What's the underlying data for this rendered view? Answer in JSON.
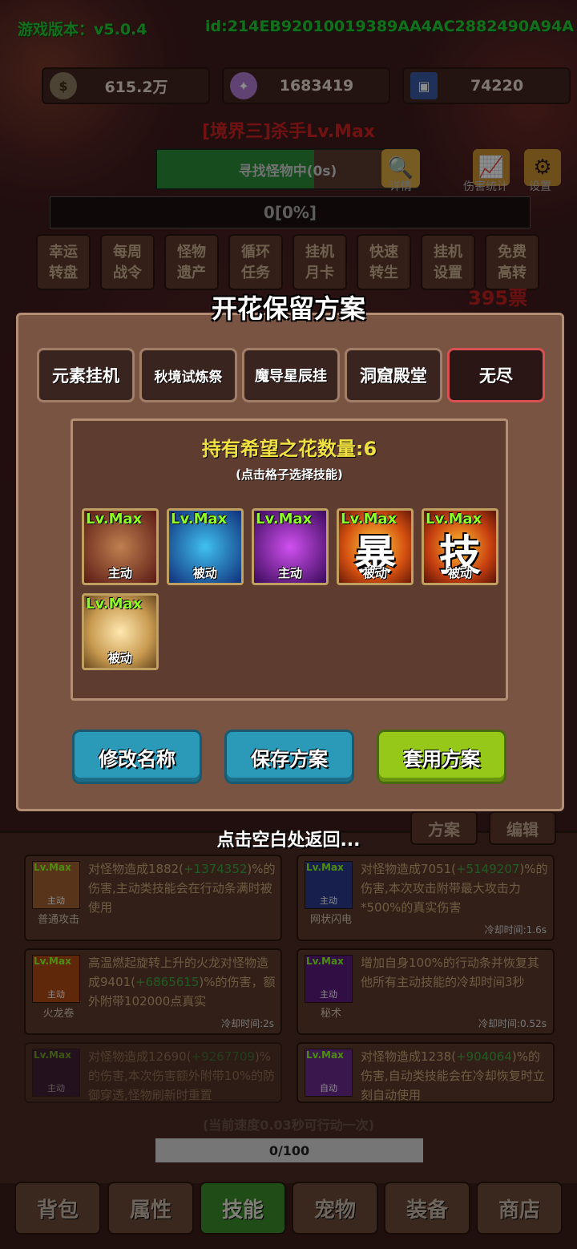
{
  "header": {
    "version_label": "游戏版本：",
    "version": "v5.0.4",
    "player_id": "id:214EB92010019389AA4AC2882490A94A"
  },
  "resources": [
    {
      "icon": "coin-icon",
      "value": "615.2万"
    },
    {
      "icon": "crystal-icon",
      "value": "1683419"
    },
    {
      "icon": "card-icon",
      "value": "74220"
    }
  ],
  "stage_title": "[境界三]杀手Lv.Max",
  "search": {
    "text": "寻找怪物中(0s)",
    "detail_label": "详情",
    "progress": 0.6
  },
  "tools": {
    "damage_stats": "伤害统计",
    "settings": "设置"
  },
  "exp_bar": {
    "text": "0[0%]"
  },
  "quick_menu": [
    {
      "l1": "幸运",
      "l2": "转盘"
    },
    {
      "l1": "每周",
      "l2": "战令"
    },
    {
      "l1": "怪物",
      "l2": "遗产"
    },
    {
      "l1": "循环",
      "l2": "任务"
    },
    {
      "l1": "挂机",
      "l2": "月卡"
    },
    {
      "l1": "快速",
      "l2": "转生"
    },
    {
      "l1": "挂机",
      "l2": "设置"
    },
    {
      "l1": "免费",
      "l2": "高转"
    }
  ],
  "background_counter": "395票",
  "modal": {
    "title": "开花保留方案",
    "tabs": [
      "元素挂机",
      "秋境试炼祭",
      "魔导星辰挂",
      "洞窟殿堂",
      "无尽"
    ],
    "active_tab": 4,
    "hope_count": "持有希望之花数量:6",
    "hint": "(点击格子选择技能)",
    "skills": [
      {
        "level": "Lv.Max",
        "tag": "主动",
        "glyph": "",
        "icon": "drill-icon",
        "color": "#5a1a14"
      },
      {
        "level": "Lv.Max",
        "tag": "被动",
        "glyph": "",
        "icon": "human-aura-icon",
        "color": "#10307a"
      },
      {
        "level": "Lv.Max",
        "tag": "主动",
        "glyph": "",
        "icon": "dark-demon-icon",
        "color": "#6a1a8a"
      },
      {
        "level": "Lv.Max",
        "tag": "被动",
        "glyph": "暴",
        "icon": "crit-fire-icon",
        "color": "#d45010"
      },
      {
        "level": "Lv.Max",
        "tag": "被动",
        "glyph": "技",
        "icon": "skill-fire-icon",
        "color": "#c84010"
      },
      {
        "level": "Lv.Max",
        "tag": "被动",
        "glyph": "",
        "icon": "golden-warrior-icon",
        "color": "#c89a50"
      }
    ],
    "buttons": {
      "rename": "修改名称",
      "save": "保存方案",
      "apply": "套用方案"
    }
  },
  "side_buttons": {
    "plan": "方案",
    "edit": "编辑"
  },
  "back_hint": "点击空白处返回...",
  "skill_cards": [
    {
      "name": "普通攻击",
      "level": "Lv.Max",
      "tag": "主动",
      "color": "#a06030",
      "desc_parts": [
        "对怪物造成1882(",
        "+1374352",
        ")%的伤害,主动类技能会在行动条满时被使用"
      ],
      "cooldown": ""
    },
    {
      "name": "网状闪电",
      "level": "Lv.Max",
      "tag": "主动",
      "color": "#2a3a8a",
      "desc_parts": [
        "对怪物造成7051(",
        "+5149207",
        ")%的伤害,本次攻击附带最大攻击力*500%的真实伤害"
      ],
      "cooldown": "冷却时间:1.6s"
    },
    {
      "name": "火龙卷",
      "level": "Lv.Max",
      "tag": "主动",
      "color": "#b04a14",
      "desc_parts": [
        "高温燃起旋转上升的火龙对怪物造成9401(",
        "+6865615",
        ")%的伤害，额外附带102000点真实"
      ],
      "cooldown": "冷却时间:2s"
    },
    {
      "name": "秘术",
      "level": "Lv.Max",
      "tag": "主动",
      "color": "#5a1a7a",
      "desc_parts": [
        "增加自身100%的行动条并恢复其他所有主动技能的冷却时间3秒",
        "",
        ""
      ],
      "cooldown": "冷却时间:0.52s"
    },
    {
      "name": "",
      "level": "Lv.Max",
      "tag": "主动",
      "color": "#3a1a4a",
      "desc_parts": [
        "对怪物造成12690(",
        "+9267709",
        ")%的伤害,本次伤害额外附带10%的防御穿透,怪物刷新时重置"
      ],
      "cooldown": ""
    },
    {
      "name": "",
      "level": "Lv.Max",
      "tag": "自动",
      "color": "#6a2a8a",
      "desc_parts": [
        "对怪物造成1238(",
        "+904064",
        ")%的伤害,自动类技能会在冷却恢复时立刻自动使用"
      ],
      "cooldown": ""
    }
  ],
  "speed_text": "(当前速度0.03秒可行动一次)",
  "action_bar": {
    "text": "0/100"
  },
  "nav": [
    "背包",
    "属性",
    "技能",
    "宠物",
    "装备",
    "商店"
  ],
  "nav_active": 2
}
